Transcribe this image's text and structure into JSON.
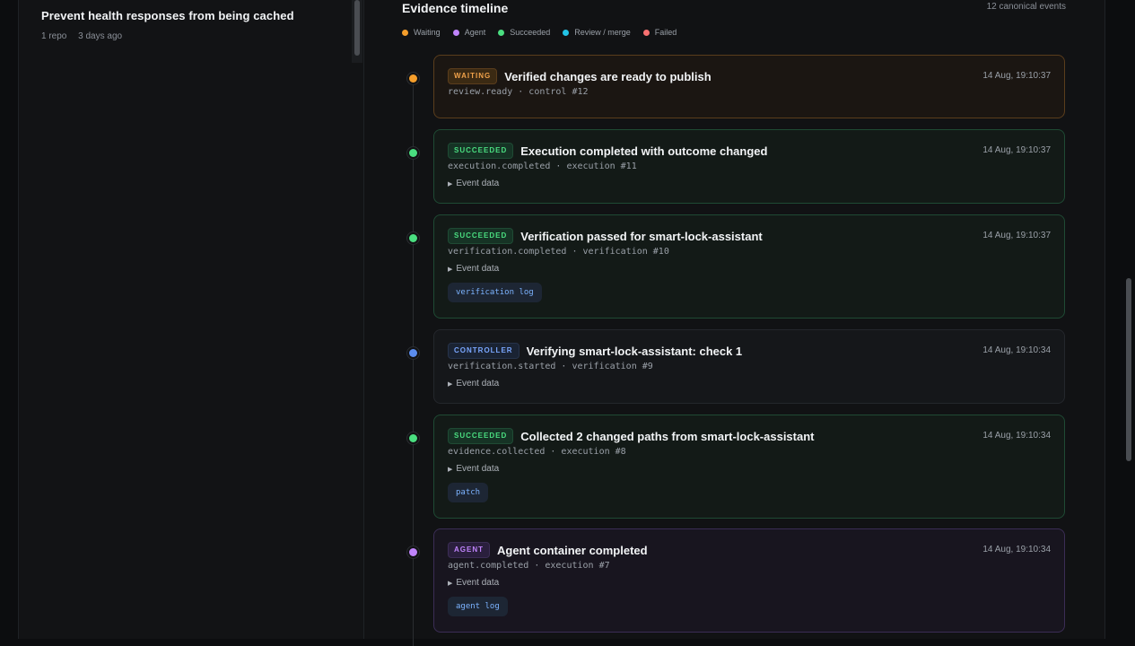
{
  "task": {
    "title": "Prevent health responses from being cached",
    "repos": "1 repo",
    "age": "3 days ago"
  },
  "timeline": {
    "title": "Evidence timeline",
    "count": "12 canonical events",
    "legend": [
      {
        "label": "Waiting",
        "color": "#f59e2b"
      },
      {
        "label": "Agent",
        "color": "#c084fc"
      },
      {
        "label": "Succeeded",
        "color": "#4ade80"
      },
      {
        "label": "Review / merge",
        "color": "#22c3e6"
      },
      {
        "label": "Failed",
        "color": "#f87171"
      }
    ],
    "events": [
      {
        "status": "WAITING",
        "title": "Verified changes are ready to publish",
        "sub": "review.ready · control #12",
        "time": "14 Aug, 19:10:37",
        "event_data": "",
        "chip": ""
      },
      {
        "status": "SUCCEEDED",
        "title": "Execution completed with outcome changed",
        "sub": "execution.completed · execution #11",
        "time": "14 Aug, 19:10:37",
        "event_data": "Event data",
        "chip": ""
      },
      {
        "status": "SUCCEEDED",
        "title": "Verification passed for smart-lock-assistant",
        "sub": "verification.completed · verification #10",
        "time": "14 Aug, 19:10:37",
        "event_data": "Event data",
        "chip": "verification log"
      },
      {
        "status": "CONTROLLER",
        "title": "Verifying smart-lock-assistant: check 1",
        "sub": "verification.started · verification #9",
        "time": "14 Aug, 19:10:34",
        "event_data": "Event data",
        "chip": ""
      },
      {
        "status": "SUCCEEDED",
        "title": "Collected 2 changed paths from smart-lock-assistant",
        "sub": "evidence.collected · execution #8",
        "time": "14 Aug, 19:10:34",
        "event_data": "Event data",
        "chip": "patch"
      },
      {
        "status": "AGENT",
        "title": "Agent container completed",
        "sub": "agent.completed · execution #7",
        "time": "14 Aug, 19:10:34",
        "event_data": "Event data",
        "chip": "agent log"
      }
    ]
  }
}
